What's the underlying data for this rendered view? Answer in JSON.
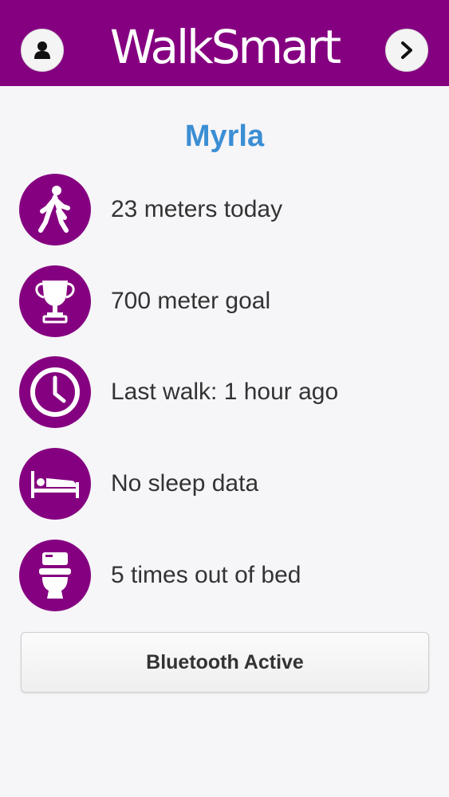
{
  "header": {
    "title": "WalkSmart",
    "left_button_icon": "user-icon",
    "right_button_icon": "chevron-right-icon",
    "background_color": "#850080"
  },
  "patient": {
    "name": "Myrla",
    "name_color": "#3b8ed3"
  },
  "stats": [
    {
      "icon": "walking-person-icon",
      "label": "23 meters today"
    },
    {
      "icon": "trophy-icon",
      "label": "700 meter goal"
    },
    {
      "icon": "clock-icon",
      "label": "Last walk: 1 hour ago"
    },
    {
      "icon": "bed-icon",
      "label": "No sleep data"
    },
    {
      "icon": "toilet-icon",
      "label": "5 times out of bed"
    }
  ],
  "bluetooth_button": {
    "label": "Bluetooth Active"
  },
  "colors": {
    "accent": "#850080",
    "background": "#f6f5f8",
    "text": "#333333"
  }
}
